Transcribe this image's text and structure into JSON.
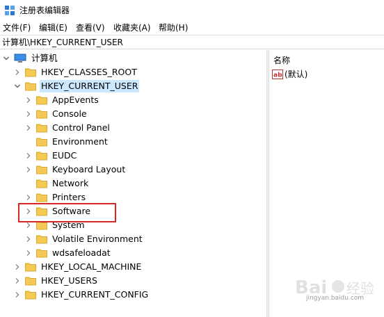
{
  "window": {
    "title": "注册表编辑器"
  },
  "menu": [
    {
      "label": "文件(F)"
    },
    {
      "label": "编辑(E)"
    },
    {
      "label": "查看(V)"
    },
    {
      "label": "收藏夹(A)"
    },
    {
      "label": "帮助(H)"
    }
  ],
  "address": {
    "path": "计算机\\HKEY_CURRENT_USER"
  },
  "tree": {
    "root": "计算机",
    "hives": {
      "classes_root": "HKEY_CLASSES_ROOT",
      "current_user": "HKEY_CURRENT_USER",
      "local_machine": "HKEY_LOCAL_MACHINE",
      "users": "HKEY_USERS",
      "current_config": "HKEY_CURRENT_CONFIG"
    },
    "current_user_children": [
      "AppEvents",
      "Console",
      "Control Panel",
      "Environment",
      "EUDC",
      "Keyboard Layout",
      "Network",
      "Printers",
      "Software",
      "System",
      "Volatile Environment",
      "wdsafeloadat"
    ]
  },
  "values_pane": {
    "column_name": "名称",
    "values": [
      {
        "name": "(默认)"
      }
    ]
  },
  "watermark": {
    "text": "jingyan.baidu.com"
  },
  "colors": {
    "selection": "#cce8ff",
    "highlight_border": "#d62828",
    "folder": "#f3c95a"
  }
}
